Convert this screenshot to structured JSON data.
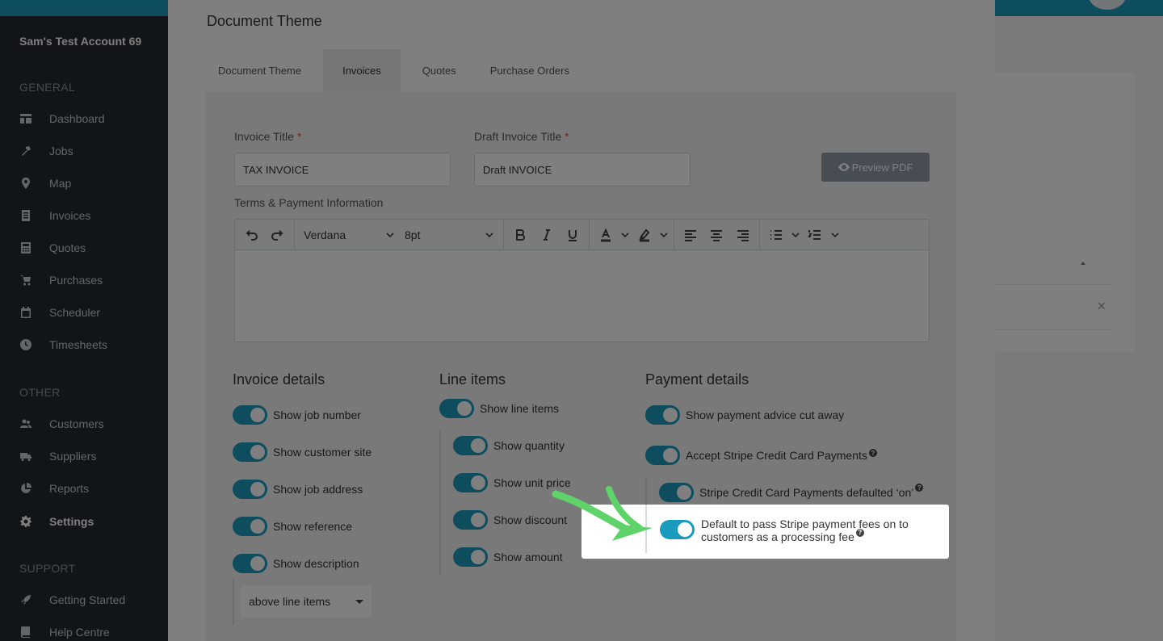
{
  "sidebar": {
    "account": "Sam's Test Account 69",
    "general_heading": "GENERAL",
    "other_heading": "OTHER",
    "support_heading": "SUPPORT",
    "general_items": [
      {
        "label": "Dashboard",
        "icon": "dashboard-icon"
      },
      {
        "label": "Jobs",
        "icon": "hammer-icon"
      },
      {
        "label": "Map",
        "icon": "map-pin-icon"
      },
      {
        "label": "Invoices",
        "icon": "invoice-icon"
      },
      {
        "label": "Quotes",
        "icon": "calculator-icon"
      },
      {
        "label": "Purchases",
        "icon": "cart-icon"
      },
      {
        "label": "Scheduler",
        "icon": "calendar-icon"
      },
      {
        "label": "Timesheets",
        "icon": "clock-icon"
      }
    ],
    "other_items": [
      {
        "label": "Customers",
        "icon": "users-icon"
      },
      {
        "label": "Suppliers",
        "icon": "truck-icon"
      },
      {
        "label": "Reports",
        "icon": "pie-chart-icon"
      },
      {
        "label": "Settings",
        "icon": "gear-icon",
        "active": true
      }
    ],
    "support_items": [
      {
        "label": "Getting Started",
        "icon": "rocket-icon"
      },
      {
        "label": "Help Centre",
        "icon": "book-icon"
      }
    ]
  },
  "modal": {
    "title": "Document Theme",
    "tabs": [
      "Document Theme",
      "Invoices",
      "Quotes",
      "Purchase Orders"
    ],
    "active_tab": "Invoices"
  },
  "form": {
    "invoice_title_label": "Invoice Title",
    "invoice_title_value": "TAX INVOICE",
    "draft_title_label": "Draft Invoice Title",
    "draft_title_value": "Draft INVOICE",
    "required_mark": "*",
    "preview_button": "Preview PDF",
    "terms_label": "Terms & Payment Information"
  },
  "editor": {
    "font": "Verdana",
    "size": "8pt"
  },
  "invoice_details": {
    "title": "Invoice details",
    "toggles": [
      "Show job number",
      "Show customer site",
      "Show job address",
      "Show reference",
      "Show description"
    ],
    "description_position": "above line items"
  },
  "line_items": {
    "title": "Line items",
    "main_toggle": "Show line items",
    "toggles": [
      "Show quantity",
      "Show unit price",
      "Show discount",
      "Show amount"
    ]
  },
  "payment_details": {
    "title": "Payment details",
    "toggles": [
      "Show payment advice cut away",
      "Accept Stripe Credit Card Payments"
    ],
    "stripe_default": "Stripe Credit Card Payments defaulted ‘on’",
    "pass_fees": "Default to pass Stripe payment fees on to customers as a processing fee",
    "help_glyph": "?"
  },
  "colors": {
    "accent": "#1a9bbd",
    "sidebar_bg": "#222a31",
    "highlight_arrow": "#5fd36a"
  }
}
